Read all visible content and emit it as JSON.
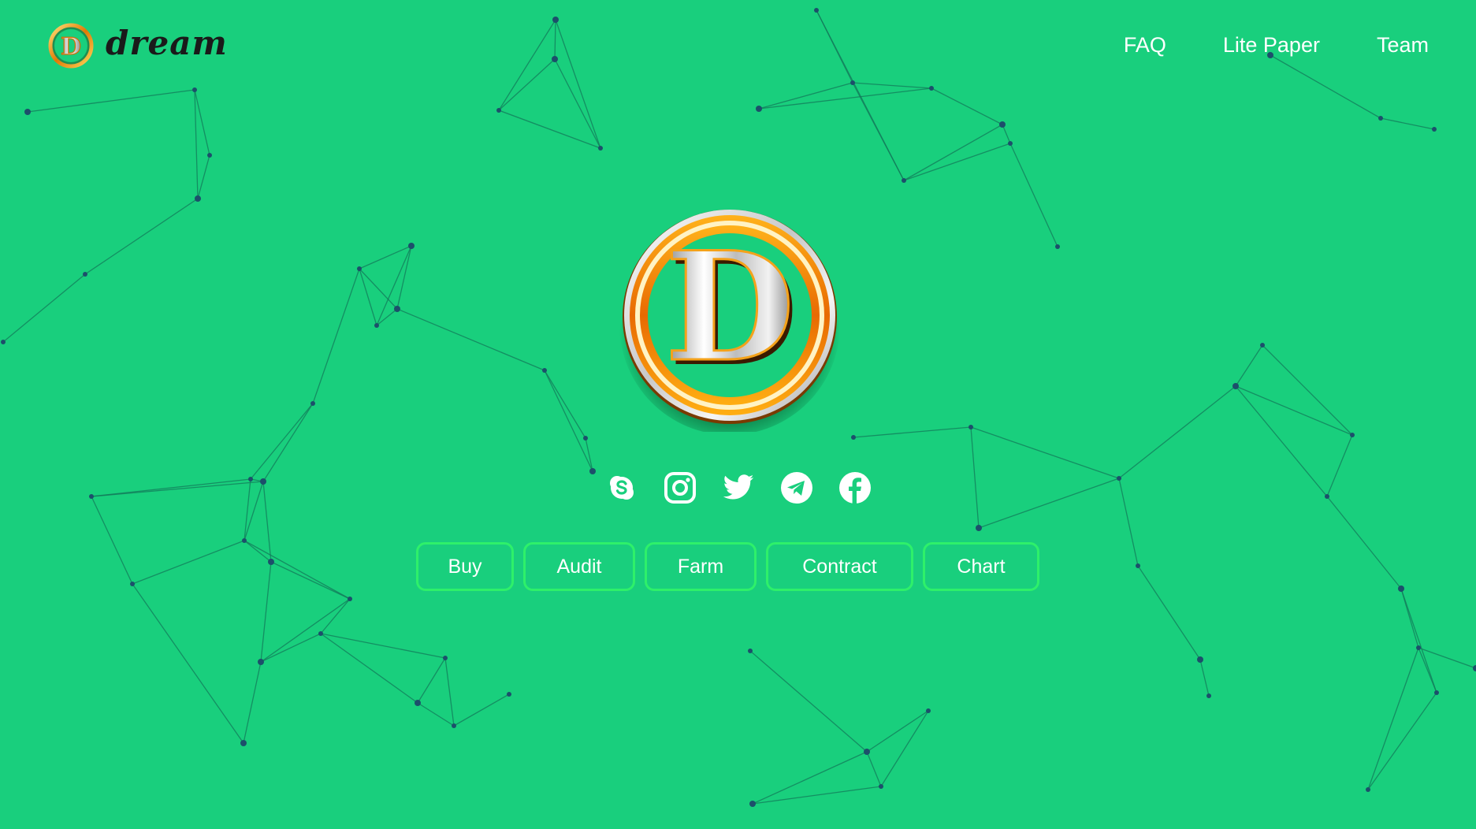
{
  "header": {
    "brand_name": "dream",
    "brand_letter": "D"
  },
  "nav": {
    "items": [
      {
        "label": "FAQ"
      },
      {
        "label": "Lite Paper"
      },
      {
        "label": "Team"
      }
    ]
  },
  "hero": {
    "logo_letter": "D"
  },
  "social": {
    "icons": [
      "skype-icon",
      "instagram-icon",
      "twitter-icon",
      "telegram-icon",
      "facebook-icon"
    ]
  },
  "actions": {
    "buy_label": "Buy",
    "audit_label": "Audit",
    "farm_label": "Farm",
    "contract_label": "Contract",
    "chart_label": "Chart"
  },
  "colors": {
    "background": "#19cf7d",
    "button_border": "#2ef06a",
    "network_line": "#13785a",
    "network_node": "#1d4f6b",
    "logo_ring": "#f3a012"
  }
}
